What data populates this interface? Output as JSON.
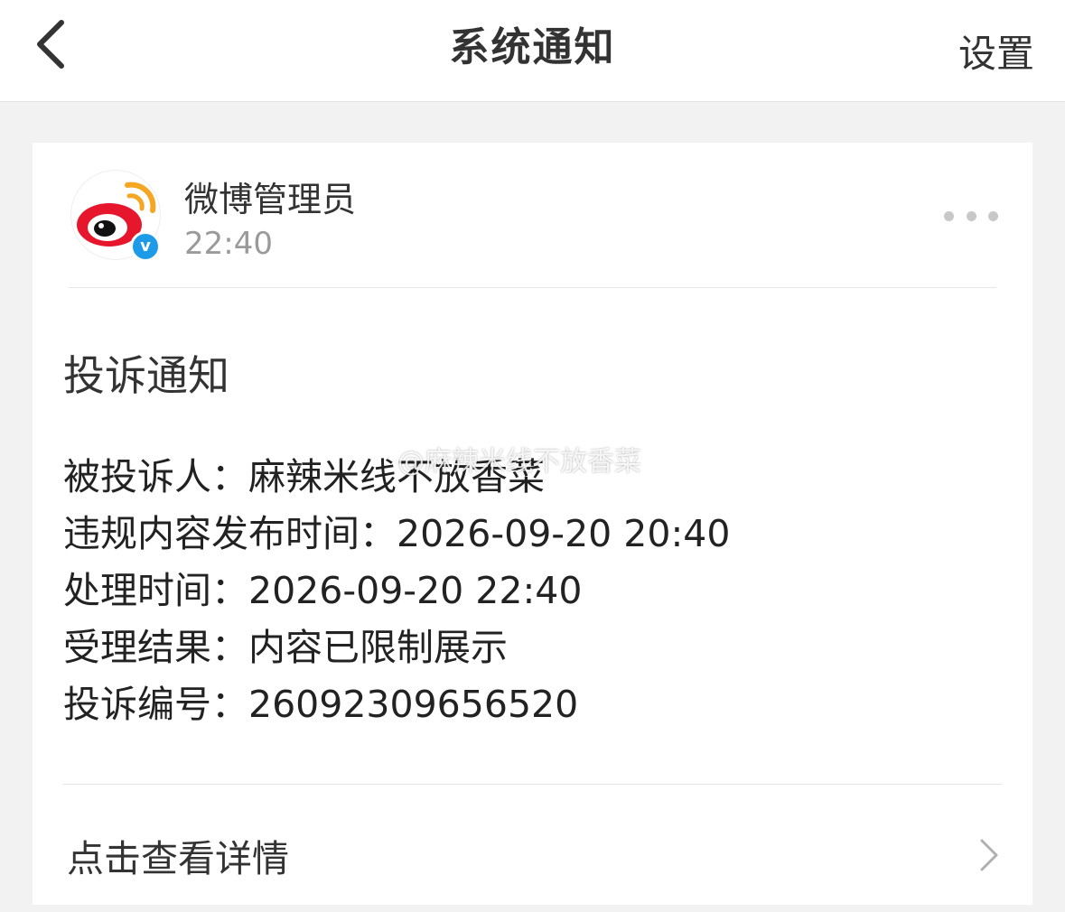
{
  "header": {
    "title": "系统通知",
    "settings_label": "设置"
  },
  "message": {
    "sender_name": "微博管理员",
    "time": "22:40",
    "title": "投诉通知",
    "details": [
      {
        "label": "被投诉人：",
        "value": "麻辣米线不放香菜"
      },
      {
        "label": "违规内容发布时间：",
        "value": "2026-09-20 20:40"
      },
      {
        "label": "处理时间：",
        "value": "2026-09-20 22:40"
      },
      {
        "label": "受理结果：",
        "value": "内容已限制展示"
      },
      {
        "label": "投诉编号：",
        "value": "26092309656520"
      }
    ],
    "view_details_label": "点击查看详情"
  },
  "watermark": "@麻辣米线不放香菜",
  "colors": {
    "brand_red": "#e6162d",
    "verified_blue": "#1e9be8",
    "background": "#f2f2f2"
  }
}
